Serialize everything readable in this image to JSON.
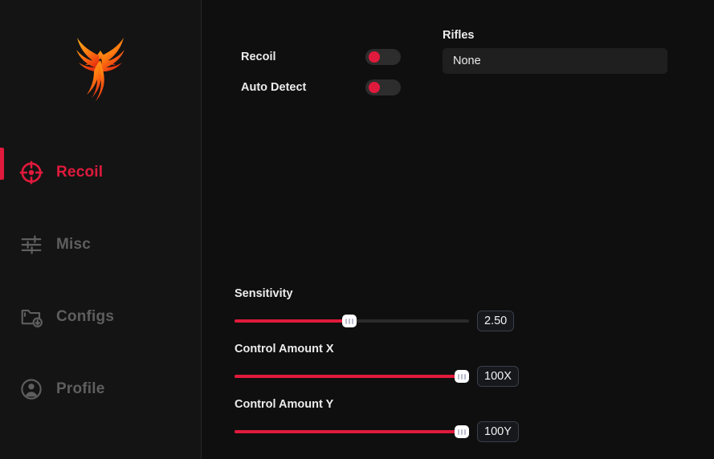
{
  "colors": {
    "accent": "#e01a3c",
    "sidebar_bg": "#141414",
    "content_bg": "#0f0f10",
    "label": "#ececec",
    "inactive_nav": "#5e5e5e"
  },
  "sidebar": {
    "logo_name": "phoenix-logo",
    "items": [
      {
        "label": "Recoil",
        "icon": "crosshair-icon",
        "active": true
      },
      {
        "label": "Misc",
        "icon": "sliders-icon",
        "active": false
      },
      {
        "label": "Configs",
        "icon": "folder-download-icon",
        "active": false
      },
      {
        "label": "Profile",
        "icon": "user-circle-icon",
        "active": false
      }
    ]
  },
  "main": {
    "toggles": [
      {
        "label": "Recoil",
        "state": "off"
      },
      {
        "label": "Auto Detect",
        "state": "off"
      }
    ],
    "weapon_select": {
      "label": "Rifles",
      "value": "None",
      "options": [
        "None"
      ]
    },
    "sliders": [
      {
        "label": "Sensitivity",
        "value": "2.50",
        "percent": 49
      },
      {
        "label": "Control Amount X",
        "value": "100X",
        "percent": 97
      },
      {
        "label": "Control Amount Y",
        "value": "100Y",
        "percent": 97
      }
    ]
  }
}
